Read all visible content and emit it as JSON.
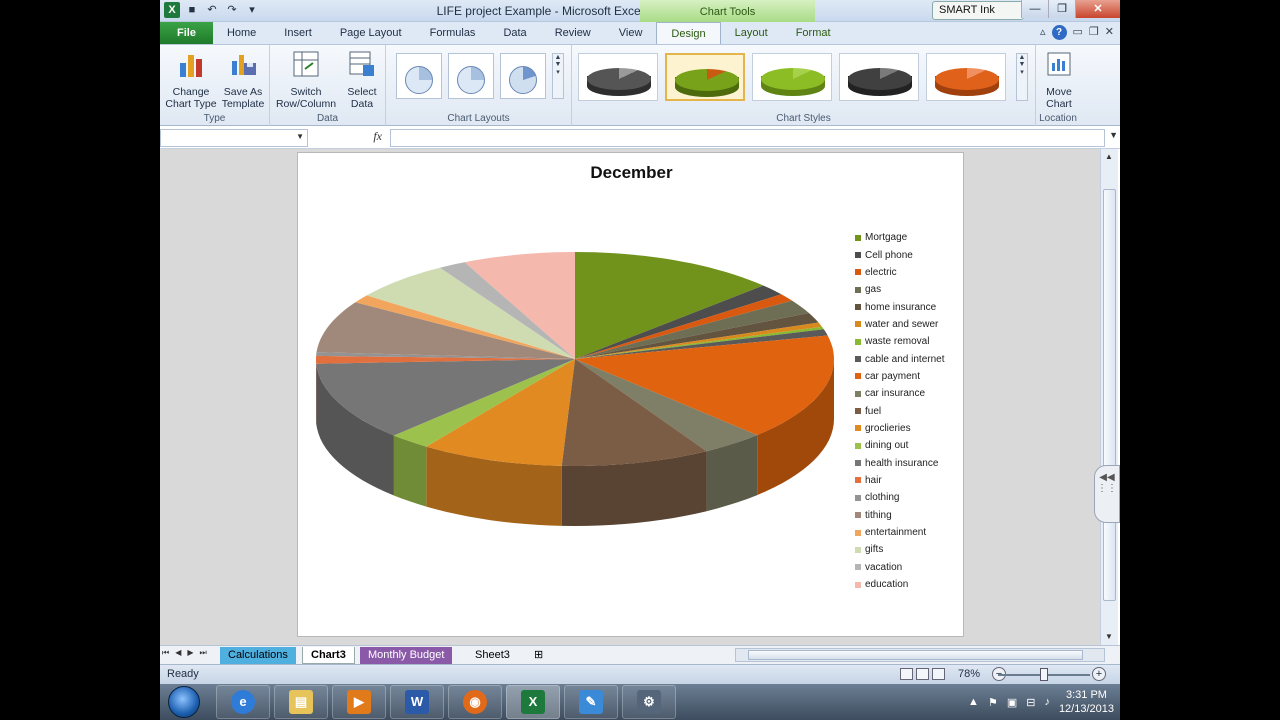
{
  "window": {
    "title": "LIFE project Example - Microsoft Excel",
    "context_tab": "Chart Tools",
    "smart_ink": "SMART Ink"
  },
  "tabs": [
    "File",
    "Home",
    "Insert",
    "Page Layout",
    "Formulas",
    "Data",
    "Review",
    "View",
    "Design",
    "Layout",
    "Format"
  ],
  "ribbon": {
    "type_group": {
      "label": "Type",
      "change_chart_type": "Change Chart Type",
      "save_as_template": "Save As Template"
    },
    "data_group": {
      "label": "Data",
      "switch_row_column": "Switch Row/Column",
      "select_data": "Select Data"
    },
    "layouts_group": {
      "label": "Chart Layouts"
    },
    "styles_group": {
      "label": "Chart Styles",
      "styles": [
        {
          "top": "#555555",
          "side": "#2e2e2e",
          "accent": "#9a9a9a"
        },
        {
          "top": "#78a21a",
          "side": "#4d6b0d",
          "accent": "#c85a12"
        },
        {
          "top": "#8dbd24",
          "side": "#5f8413",
          "accent": "#a8d14b"
        },
        {
          "top": "#404040",
          "side": "#222222",
          "accent": "#7a7a7a"
        },
        {
          "top": "#e0621a",
          "side": "#a0400c",
          "accent": "#f09060"
        }
      ]
    },
    "location_group": {
      "label": "Location",
      "move_chart": "Move Chart"
    }
  },
  "formula_bar": {
    "fx": "fx",
    "name_box": "",
    "formula": ""
  },
  "chart_data": {
    "type": "pie",
    "title": "December",
    "categories": [
      "Mortgage",
      "Cell phone",
      "electric",
      "gas",
      "home insurance",
      "water and sewer",
      "waste removal",
      "cable and internet",
      "car payment",
      "car insurance",
      "fuel",
      "groclieries",
      "dining out",
      "health insurance",
      "hair",
      "clothing",
      "tithing",
      "entertainment",
      "gifts",
      "vacation",
      "education"
    ],
    "values": [
      13.5,
      1.8,
      1.2,
      2.2,
      1.6,
      0.7,
      0.4,
      1.0,
      16.8,
      4.1,
      9.7,
      9.3,
      2.7,
      12.5,
      1.2,
      0.6,
      8.2,
      1.3,
      6.4,
      1.8,
      7.3
    ],
    "colors": [
      "#71931b",
      "#4d4d4d",
      "#d8590f",
      "#6e6e54",
      "#635440",
      "#d88a1e",
      "#8ab832",
      "#5a5a5a",
      "#e0640f",
      "#7f7e66",
      "#7b5d45",
      "#e28a22",
      "#9cc24d",
      "#767676",
      "#e2703e",
      "#939393",
      "#a0897a",
      "#f2a65d",
      "#cfdcb2",
      "#b5b5b5",
      "#f4b8ad"
    ],
    "legend": "right",
    "style": "3-D pie"
  },
  "sheets": {
    "tabs": [
      {
        "name": "Calculations",
        "color": "#4fb0e0"
      },
      {
        "name": "Chart3",
        "color": "#ffffff"
      },
      {
        "name": "Monthly Budget",
        "color": "#8a5aa8"
      },
      {
        "name": "Sheet3",
        "color": "#eef2f7"
      }
    ]
  },
  "status": {
    "ready": "Ready",
    "zoom": "78%",
    "zoom_level": 0.5
  },
  "taskbar": {
    "apps": [
      "internet-explorer",
      "file-explorer",
      "media-player",
      "microsoft-word",
      "firefox",
      "microsoft-excel",
      "smart-notebook",
      "smart-tools"
    ],
    "time": "3:31 PM",
    "date": "12/13/2013"
  }
}
